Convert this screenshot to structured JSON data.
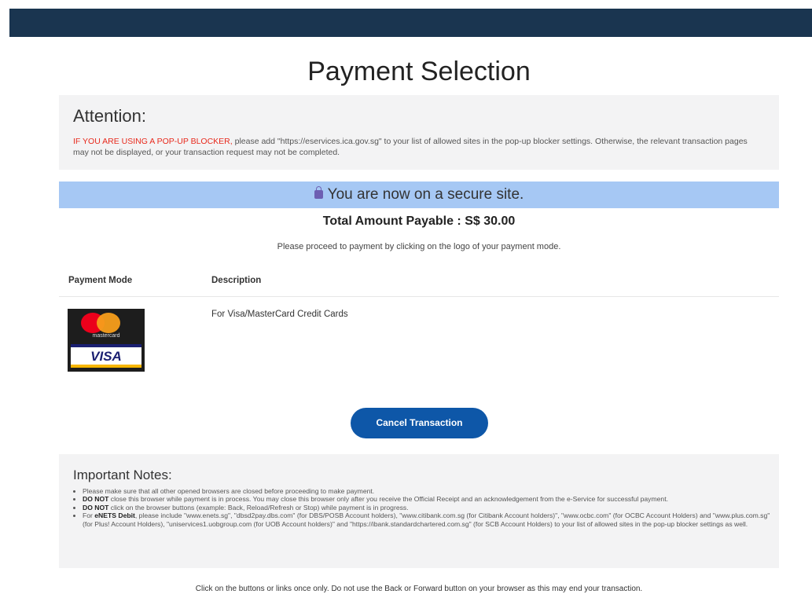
{
  "page": {
    "title": "Payment Selection"
  },
  "attention": {
    "title": "Attention:",
    "warning": "IF YOU ARE USING A POP-UP BLOCKER,",
    "text": " please add \"https://eservices.ica.gov.sg\" to your list of allowed sites in the pop-up blocker settings. Otherwise, the relevant transaction pages may not be displayed, or your transaction request may not be completed."
  },
  "secure": {
    "icon": "lock-icon",
    "text": "You are now on a secure site."
  },
  "payment": {
    "total": "Total Amount Payable : S$ 30.00",
    "instruction": "Please proceed to payment by clicking on the logo of your payment mode.",
    "col_mode": "Payment Mode",
    "col_description": "Description",
    "card_logo_text": "mastercard",
    "visa_text": "VISA",
    "card_description": "For Visa/MasterCard Credit Cards"
  },
  "actions": {
    "cancel_label": "Cancel Transaction"
  },
  "notes": {
    "title": "Important Notes:",
    "item1": "Please make sure that all other opened browsers are closed before proceeding to make payment.",
    "item2_bold": "DO NOT",
    "item2": " close this browser while payment is in process. You may close this browser only after you receive the Official Receipt and an acknowledgement from the e-Service for successful payment.",
    "item3_bold": "DO NOT",
    "item3": " click on the browser buttons (example: Back, Reload/Refresh or Stop) while payment is in progress.",
    "item4_prefix": "For ",
    "item4_bold": "eNETS Debit",
    "item4": ", please include \"www.enets.sg\", \"dbsd2pay.dbs.com\" (for DBS/POSB Account holders), \"www.citibank.com.sg (for Citibank Account holders)\", \"www.ocbc.com\" (for OCBC Account Holders) and \"www.plus.com.sg\" (for Plus! Account Holders), \"uniservices1.uobgroup.com (for UOB Account holders)\" and \"https://ibank.standardchartered.com.sg\" (for SCB Account Holders) to your list of allowed sites in the pop-up blocker settings as well."
  },
  "footer": {
    "text": "Click on the buttons or links once only. Do not use the Back or Forward button on your browser as this may end your transaction."
  },
  "colors": {
    "header_bar": "#1a3550",
    "secure_bar": "#a6c8f4",
    "button": "#0e57a8",
    "warning": "#e8291c"
  }
}
